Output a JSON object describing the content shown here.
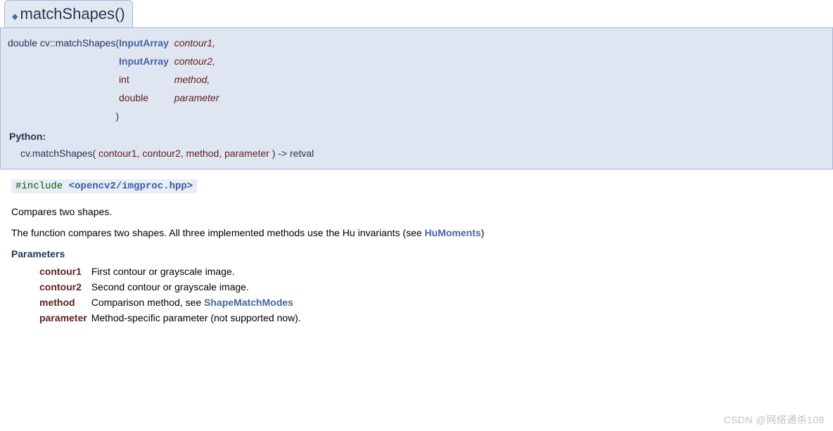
{
  "title": {
    "bullet": "◆ ",
    "name": "matchShapes()"
  },
  "signature": {
    "return_and_name": "double cv::matchShapes",
    "open_paren": "( ",
    "close_paren": ")",
    "params": [
      {
        "type_link": "InputArray",
        "type_rest": "  ",
        "name": "contour1",
        "comma": ","
      },
      {
        "type_link": "InputArray",
        "type_rest": "  ",
        "name": "contour2",
        "comma": ","
      },
      {
        "type_plain": "int",
        "name": "method",
        "comma": ","
      },
      {
        "type_plain": "double",
        "name": "parameter",
        "comma": ""
      }
    ]
  },
  "python": {
    "label": "Python:",
    "prefix": "cv.matchShapes(",
    "args_text": " contour1, contour2, method, parameter ",
    "suffix": ") -> retval"
  },
  "include": {
    "hash": "#include ",
    "path": "<opencv2/imgproc.hpp>"
  },
  "desc1": "Compares two shapes.",
  "desc2_pre": "The function compares two shapes. All three implemented methods use the Hu invariants (see ",
  "desc2_link": "HuMoments",
  "desc2_post": ")",
  "params_header": "Parameters",
  "params": [
    {
      "name": "contour1",
      "desc": "First contour or grayscale image."
    },
    {
      "name": "contour2",
      "desc": "Second contour or grayscale image."
    },
    {
      "name": "method",
      "desc_pre": "Comparison method, see ",
      "link": "ShapeMatchModes"
    },
    {
      "name": "parameter",
      "desc": "Method-specific parameter (not supported now)."
    }
  ],
  "watermark": "CSDN @网络通杀108"
}
